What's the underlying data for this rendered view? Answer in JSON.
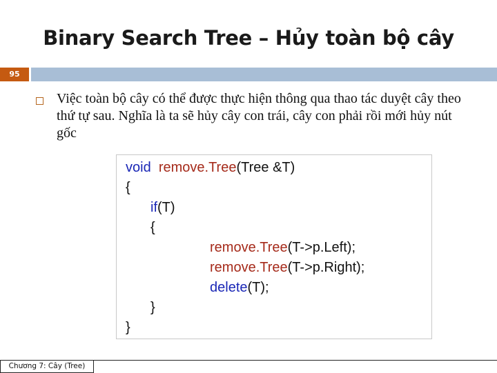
{
  "slide": {
    "title": "Binary Search Tree – Hủy toàn bộ cây",
    "page_number": "95",
    "bullet": "Việc toàn bộ cây có thể được thực hiện thông qua thao tác duyệt cây theo thứ tự sau. Nghĩa là ta sẽ hủy cây con trái, cây con phải rồi mới hủy nút gốc",
    "footer": "Chương 7: Cây (Tree)"
  },
  "code": {
    "l1_kw": "void",
    "l1_fn": "remove.Tree",
    "l1_args": "(Tree &T)",
    "l2": "{",
    "l3_kw": "if",
    "l3_rest": "(T)",
    "l4": "{",
    "l5_fn": "remove.Tree",
    "l5_rest": "(T->p.Left);",
    "l6_fn": "remove.Tree",
    "l6_rest": "(T->p.Right);",
    "l7_kw": "delete",
    "l7_rest": "(T);",
    "l8": "}",
    "l9": "}"
  },
  "colors": {
    "accent_bar": "#a8bed6",
    "page_number_bg": "#c55a11",
    "keyword": "#1a27b6",
    "function": "#a52a1a"
  }
}
